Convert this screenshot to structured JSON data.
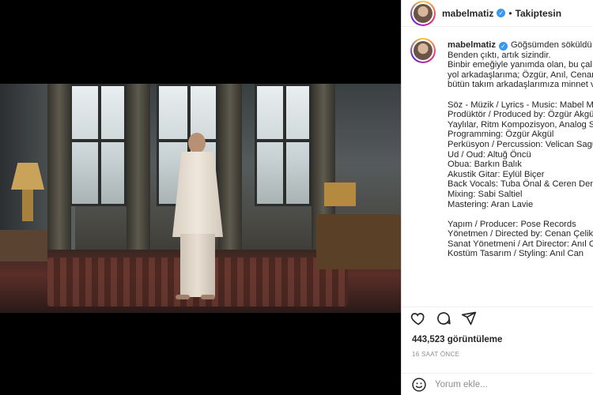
{
  "header": {
    "username": "mabelmatiz",
    "verified_icon": "verified-badge-icon",
    "follow_status": "Takiptesin"
  },
  "caption": {
    "username": "mabelmatiz",
    "lines": [
      "Göğsümden söküldü \"",
      "Benden çıktı, artık sizindir.",
      "Binbir emeğiyle yanımda olan, bu çalış",
      "yol arkadaşlarıma; Özgür, Anıl, Cenan,",
      "bütün takım arkadaşlarımıza minnet v",
      "",
      "Söz - Müzik / Lyrics - Music: Mabel M",
      "Prodüktör / Produced by: Özgür Akgü",
      "Yaylılar, Ritm Kompozisyon, Analog Sy",
      "Programming: Özgür Akgül",
      "Perküsyon / Percussion: Velican Sagun",
      "Ud / Oud: Altuğ Öncü",
      "Obua: Barkın Balık",
      "Akustik Gitar: Eylül Biçer",
      "Back Vocals: Tuba Önal & Ceren Deniz",
      "Mixing: Sabi Saltiel",
      "Mastering: Aran Lavie",
      "",
      "Yapım / Producer: Pose Records",
      "Yönetmen / Directed by: Cenan Çelik",
      "Sanat Yönetmeni / Art Director: Anıl Ca",
      "Kostüm Tasarım / Styling: Anıl Can"
    ]
  },
  "actions": {
    "like_icon": "heart-icon",
    "comment_icon": "comment-icon",
    "share_icon": "share-icon"
  },
  "stats": {
    "views": "443,523 görüntüleme",
    "time_ago": "16 SAAT ÖNCE"
  },
  "comment": {
    "emoji_icon": "smiley-icon",
    "placeholder": "Yorum ekle..."
  },
  "colors": {
    "verified": "#3897f0",
    "text": "#262626",
    "muted": "#8e8e8e",
    "media_bg": "#000000"
  }
}
